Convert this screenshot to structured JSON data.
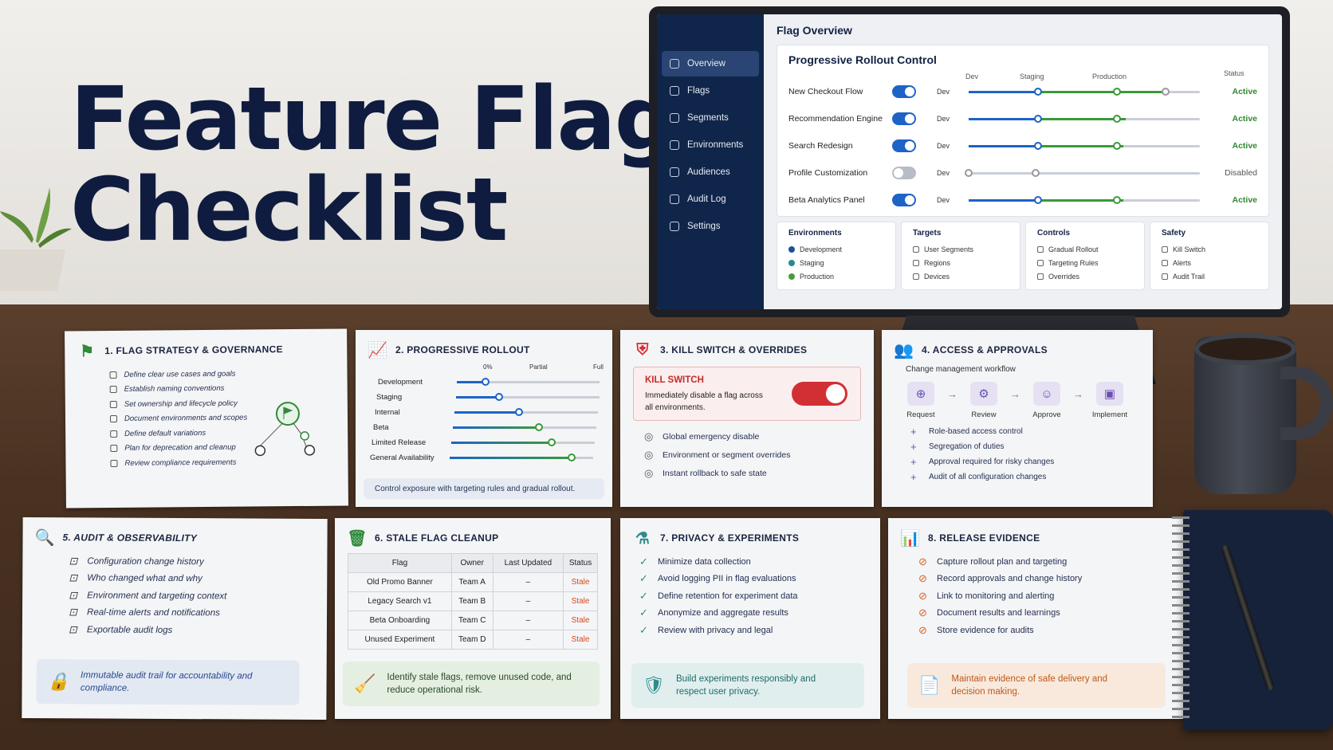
{
  "title": {
    "line1": "Feature Flag",
    "line2": "Checklist"
  },
  "dashboard": {
    "nav": [
      "Overview",
      "Flags",
      "Segments",
      "Environments",
      "Audiences",
      "Audit Log",
      "Settings"
    ],
    "heading": "Flag Overview",
    "panel_title": "Progressive Rollout Control",
    "col_headers": {
      "dev": "Dev",
      "staging": "Staging",
      "production": "Production",
      "status": "Status"
    },
    "flags": [
      {
        "name": "New Checkout Flow",
        "env": "Dev",
        "on": true,
        "progress": 0.85,
        "status": "Active"
      },
      {
        "name": "Recommendation Engine",
        "env": "Dev",
        "on": true,
        "progress": 0.68,
        "status": "Active"
      },
      {
        "name": "Search Redesign",
        "env": "Dev",
        "on": true,
        "progress": 0.67,
        "status": "Active"
      },
      {
        "name": "Profile Customization",
        "env": "Dev",
        "on": false,
        "progress": 0.29,
        "status": "Disabled"
      },
      {
        "name": "Beta Analytics Panel",
        "env": "Dev",
        "on": true,
        "progress": 0.67,
        "status": "Active"
      }
    ],
    "boxes": [
      {
        "title": "Environments",
        "items": [
          "Development",
          "Staging",
          "Production"
        ]
      },
      {
        "title": "Targets",
        "items": [
          "User Segments",
          "Regions",
          "Devices"
        ]
      },
      {
        "title": "Controls",
        "items": [
          "Gradual Rollout",
          "Targeting Rules",
          "Overrides"
        ]
      },
      {
        "title": "Safety",
        "items": [
          "Kill Switch",
          "Alerts",
          "Audit Trail"
        ]
      }
    ],
    "env_colors": [
      "#1d4f9a",
      "#2a8a8a",
      "#4a9a3a"
    ]
  },
  "cards": {
    "c1": {
      "title": "1. FLAG STRATEGY & GOVERNANCE",
      "items": [
        "Define clear use cases and goals",
        "Establish naming conventions",
        "Set ownership and lifecycle policy",
        "Document environments and scopes",
        "Define default variations",
        "Plan for deprecation and cleanup",
        "Review compliance requirements"
      ]
    },
    "c2": {
      "title": "2. PROGRESSIVE ROLLOUT",
      "scale": [
        "0%",
        "Partial",
        "Full"
      ],
      "rows": [
        {
          "label": "Development",
          "value": 0.2
        },
        {
          "label": "Staging",
          "value": 0.3
        },
        {
          "label": "Internal",
          "value": 0.45
        },
        {
          "label": "Beta",
          "value": 0.6
        },
        {
          "label": "Limited Release",
          "value": 0.7
        },
        {
          "label": "General Availability",
          "value": 0.85
        }
      ],
      "note": "Control exposure with targeting rules and gradual rollout."
    },
    "c3": {
      "title": "3. KILL SWITCH & OVERRIDES",
      "kill_title": "KILL SWITCH",
      "kill_text": "Immediately disable a flag across all environments.",
      "items": [
        "Global emergency disable",
        "Environment or segment overrides",
        "Instant rollback to safe state"
      ]
    },
    "c4": {
      "title": "4. ACCESS & APPROVALS",
      "subtitle": "Change management workflow",
      "steps": [
        "Request",
        "Review",
        "Approve",
        "Implement"
      ],
      "items": [
        "Role-based access control",
        "Segregation of duties",
        "Approval required for risky changes",
        "Audit of all configuration changes"
      ]
    },
    "c5": {
      "title": "5. AUDIT & OBSERVABILITY",
      "items": [
        "Configuration change history",
        "Who changed what and why",
        "Environment and targeting context",
        "Real-time alerts and notifications",
        "Exportable audit logs"
      ],
      "note": "Immutable audit trail for accountability and compliance."
    },
    "c6": {
      "title": "6. STALE FLAG CLEANUP",
      "headers": [
        "Flag",
        "Owner",
        "Last Updated",
        "Status"
      ],
      "rows": [
        [
          "Old Promo Banner",
          "Team A",
          "–",
          "Stale"
        ],
        [
          "Legacy Search v1",
          "Team B",
          "–",
          "Stale"
        ],
        [
          "Beta Onboarding",
          "Team C",
          "–",
          "Stale"
        ],
        [
          "Unused Experiment",
          "Team D",
          "–",
          "Stale"
        ]
      ],
      "note": "Identify stale flags, remove unused code, and reduce operational risk."
    },
    "c7": {
      "title": "7. PRIVACY & EXPERIMENTS",
      "items": [
        "Minimize data collection",
        "Avoid logging PII in flag evaluations",
        "Define retention for experiment data",
        "Anonymize and aggregate results",
        "Review with privacy and legal"
      ],
      "note": "Build experiments responsibly and respect user privacy."
    },
    "c8": {
      "title": "8. RELEASE EVIDENCE",
      "items": [
        "Capture rollout plan and targeting",
        "Record approvals and change history",
        "Link to monitoring and alerting",
        "Document results and learnings",
        "Store evidence for audits"
      ],
      "note": "Maintain evidence of safe delivery and decision making."
    }
  }
}
